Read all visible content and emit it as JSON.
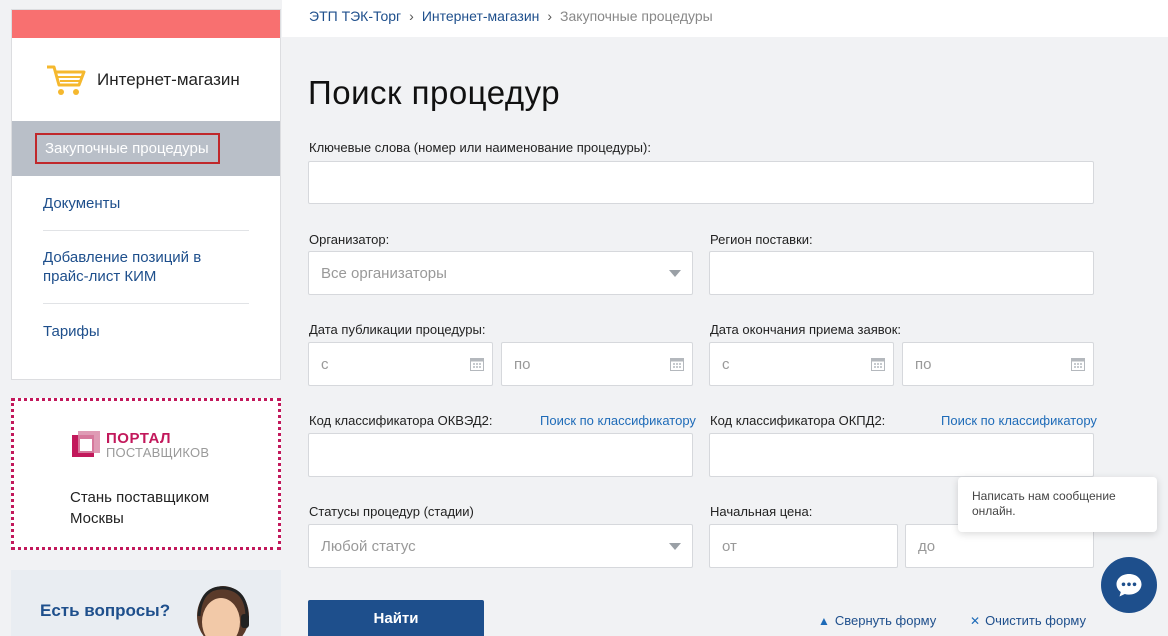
{
  "breadcrumb": {
    "items": [
      "ЭТП ТЭК-Торг",
      "Интернет-магазин"
    ],
    "separator": "›",
    "current": "Закупочные процедуры"
  },
  "sidebar": {
    "brand_title": "Интернет-магазин",
    "active_item": "Закупочные процедуры",
    "items": [
      {
        "label": "Документы"
      },
      {
        "label": "Добавление позиций в прайс-лист КИМ"
      },
      {
        "label": "Тарифы"
      }
    ]
  },
  "promo": {
    "logo_line1": "ПОРТАЛ",
    "logo_line2": "ПОСТАВЩИКОВ",
    "text": "Стань поставщиком Москвы"
  },
  "questions": {
    "title": "Есть вопросы?"
  },
  "page_title": "Поиск процедур",
  "form": {
    "keywords_label": "Ключевые слова (номер или наименование процедуры):",
    "organizer_label": "Организатор:",
    "organizer_value": "Все организаторы",
    "region_label": "Регион поставки:",
    "pub_date_label": "Дата публикации процедуры:",
    "end_date_label": "Дата окончания приема заявок:",
    "from_placeholder": "с",
    "to_placeholder": "по",
    "okved_label": "Код классификатора ОКВЭД2:",
    "okpd_label": "Код классификатора ОКПД2:",
    "classifier_link": "Поиск по классификатору",
    "status_label": "Статусы процедур (стадии)",
    "status_value": "Любой статус",
    "price_label": "Начальная цена:",
    "price_from": "от",
    "price_to": "до",
    "submit": "Найти",
    "collapse": "Свернуть форму",
    "clear": "Очистить форму"
  },
  "chat": {
    "popup_text": "Написать нам сообщение онлайн."
  },
  "colors": {
    "accent": "#1e4f8c",
    "topbar": "#f87070",
    "promo_border": "#c2185b"
  }
}
